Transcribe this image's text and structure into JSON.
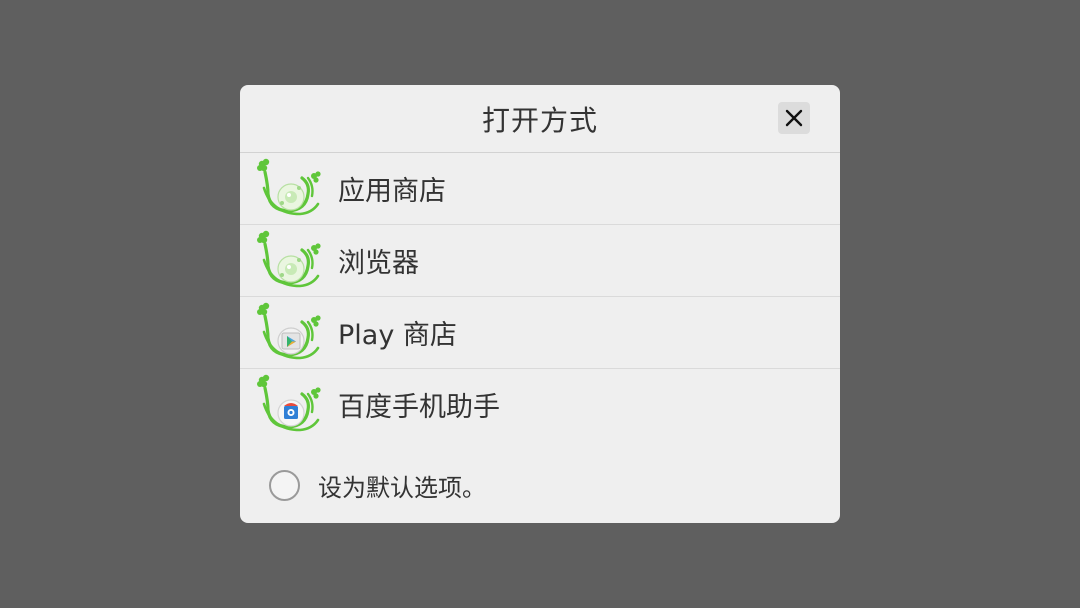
{
  "dialog": {
    "title": "打开方式",
    "close_icon": "close-icon"
  },
  "apps": [
    {
      "label": "应用商店",
      "icon": "app-store-icon",
      "badge": "clover-green"
    },
    {
      "label": "浏览器",
      "icon": "browser-icon",
      "badge": "clover-green"
    },
    {
      "label": "Play 商店",
      "icon": "play-store-icon",
      "badge": "play-triangle"
    },
    {
      "label": "百度手机助手",
      "icon": "baidu-assistant-icon",
      "badge": "baidu-bag"
    }
  ],
  "default_option": {
    "label": "设为默认选项。",
    "checked": false
  },
  "colors": {
    "backdrop": "#5f5f5f",
    "dialog": "#efefef",
    "accent_green": "#5fc63a",
    "text": "#333333"
  }
}
